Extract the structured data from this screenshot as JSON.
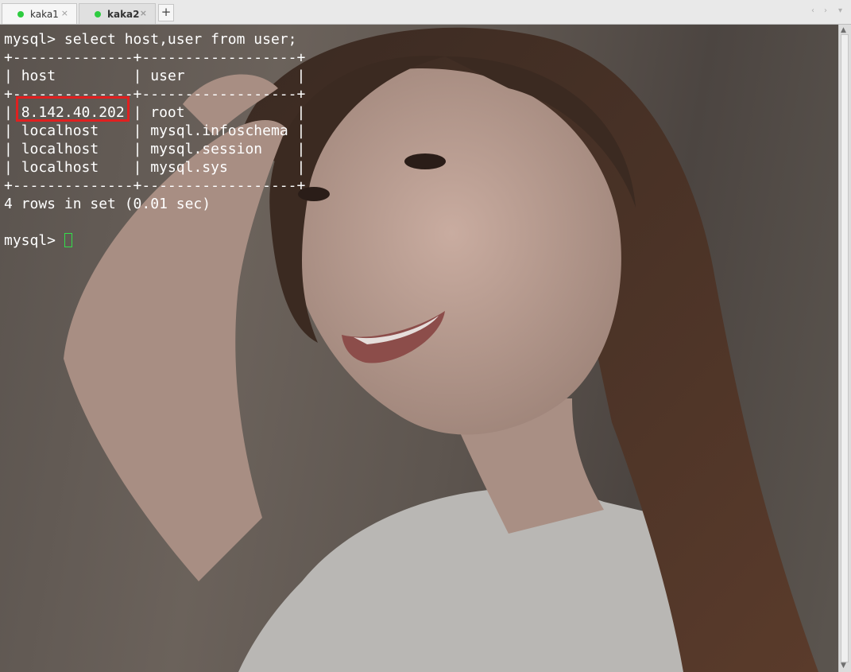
{
  "tabs": [
    {
      "label": "kaka1",
      "status_color": "#2ecc40",
      "close_glyph": "×"
    },
    {
      "label": "kaka2",
      "status_color": "#2ecc40",
      "close_glyph": "×",
      "active": true
    }
  ],
  "tabbar": {
    "new_tab_glyph": "+",
    "nav_left": "‹",
    "nav_right": "›",
    "menu": "▾"
  },
  "terminal": {
    "command_line": "mysql> select host,user from user;",
    "table_border": "+--------------+------------------+",
    "columns": [
      "host",
      "user"
    ],
    "rows": [
      {
        "host": "8.142.40.202",
        "user": "root"
      },
      {
        "host": "localhost",
        "user": "mysql.infoschema"
      },
      {
        "host": "localhost",
        "user": "mysql.session"
      },
      {
        "host": "localhost",
        "user": "mysql.sys"
      }
    ],
    "result_summary": "4 rows in set (0.01 sec)",
    "prompt": "mysql> ",
    "highlight_color": "#e02020",
    "cursor_color": "#33e04a"
  },
  "scrollbar": {
    "up_glyph": "▲",
    "down_glyph": "▼"
  }
}
